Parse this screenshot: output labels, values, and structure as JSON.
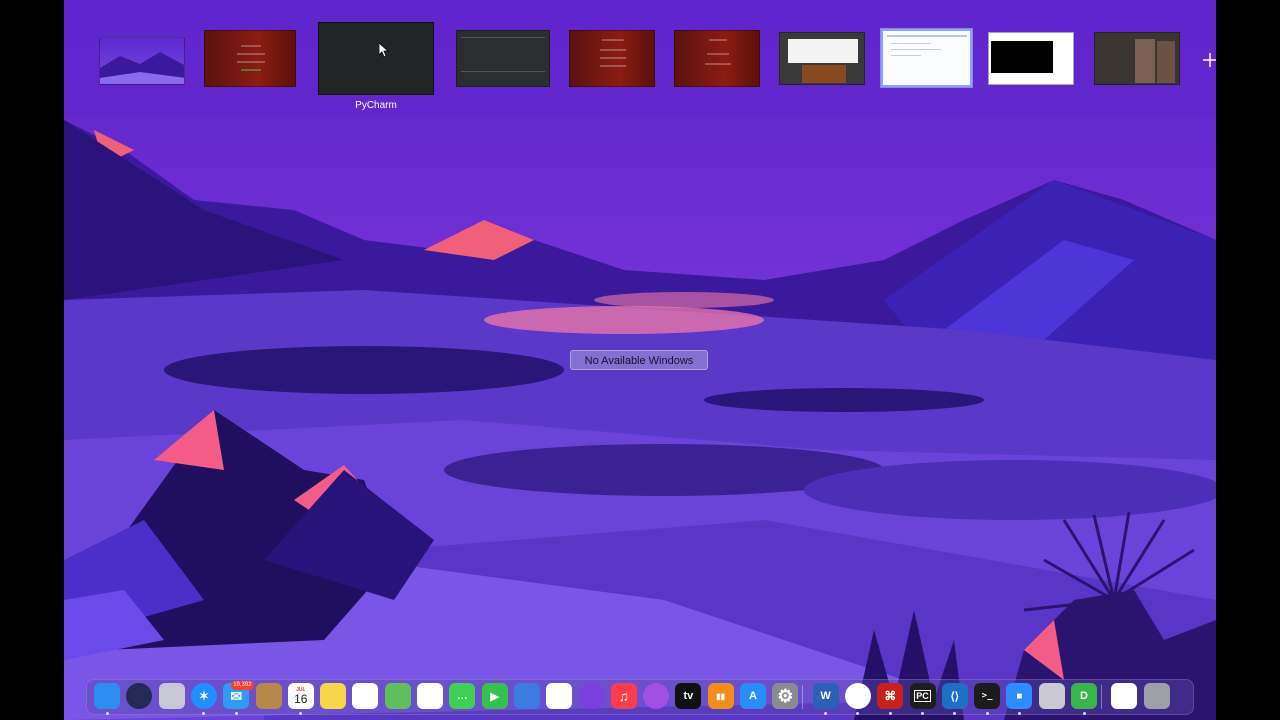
{
  "colors": {
    "wallpaper_sky": "#6d2fd6",
    "spaces_bar": "#6226cd",
    "selected_border": "#7fa9ff"
  },
  "spaces": {
    "items": [
      {
        "name": "wallpaper-desktop",
        "label": ""
      },
      {
        "name": "red-login-window",
        "label": ""
      },
      {
        "name": "pycharm-window",
        "label": "PyCharm"
      },
      {
        "name": "dark-editor-window",
        "label": ""
      },
      {
        "name": "red-form-window",
        "label": ""
      },
      {
        "name": "red-welcome-window",
        "label": ""
      },
      {
        "name": "browser-window",
        "label": ""
      },
      {
        "name": "selected-document-window",
        "label": ""
      },
      {
        "name": "video-window",
        "label": ""
      },
      {
        "name": "media-window",
        "label": ""
      }
    ],
    "add_icon": "plus-icon",
    "cursor_icon": "pointer-cursor-icon"
  },
  "desktop": {
    "no_windows_label": "No Available Windows"
  },
  "dock": {
    "apps": [
      {
        "name": "finder",
        "icon": "finder-icon",
        "color": "#2d8cf0",
        "running": true
      },
      {
        "name": "siri",
        "icon": "siri-icon",
        "color": "#232a55",
        "running": false
      },
      {
        "name": "launchpad",
        "icon": "launchpad-icon",
        "color": "#c7c7d6",
        "running": false
      },
      {
        "name": "safari",
        "icon": "safari-icon",
        "color": "#1e90ff",
        "running": true
      },
      {
        "name": "mail",
        "icon": "mail-icon",
        "color": "#2f9bf3",
        "running": true,
        "badge": "19,392"
      },
      {
        "name": "contacts",
        "icon": "contacts-icon",
        "color": "#b8884a",
        "running": false
      },
      {
        "name": "calendar",
        "icon": "calendar-icon",
        "color": "#ffffff",
        "running": true,
        "month": "JUL",
        "day": "16"
      },
      {
        "name": "notes",
        "icon": "notes-icon",
        "color": "#f7d64a",
        "running": false
      },
      {
        "name": "reminders",
        "icon": "reminders-icon",
        "color": "#ffffff",
        "running": false
      },
      {
        "name": "maps",
        "icon": "maps-icon",
        "color": "#5fbf5f",
        "running": false
      },
      {
        "name": "photos",
        "icon": "photos-icon",
        "color": "#ffffff",
        "running": false
      },
      {
        "name": "messages",
        "icon": "messages-icon",
        "color": "#3fcf55",
        "running": false
      },
      {
        "name": "facetime",
        "icon": "facetime-icon",
        "color": "#35c24c",
        "running": false
      },
      {
        "name": "keynote",
        "icon": "keynote-icon",
        "color": "#3e7be0",
        "running": false
      },
      {
        "name": "news",
        "icon": "news-icon",
        "color": "#ffffff",
        "running": false
      },
      {
        "name": "podcasts-radio",
        "icon": "radio-icon",
        "color": "#7b3fe0",
        "running": false
      },
      {
        "name": "music",
        "icon": "music-icon",
        "color": "#fa3c4c",
        "running": false
      },
      {
        "name": "podcasts",
        "icon": "podcasts-icon",
        "color": "#a050e0",
        "running": false
      },
      {
        "name": "apple-tv",
        "icon": "tv-icon",
        "color": "#111111",
        "label": "tv",
        "running": false
      },
      {
        "name": "books",
        "icon": "books-icon",
        "color": "#f28c1a",
        "running": false
      },
      {
        "name": "app-store",
        "icon": "app-store-icon",
        "color": "#2a8cf5",
        "running": false
      },
      {
        "name": "system-preferences",
        "icon": "gear-icon",
        "color": "#8a8a92",
        "running": false
      },
      {
        "name": "word",
        "icon": "word-icon",
        "color": "#2b5fb8",
        "label": "W",
        "running": true
      },
      {
        "name": "chrome",
        "icon": "chrome-icon",
        "color": "#ffffff",
        "running": true
      },
      {
        "name": "acrobat",
        "icon": "acrobat-icon",
        "color": "#c8201b",
        "running": true
      },
      {
        "name": "pycharm",
        "icon": "pycharm-icon",
        "color": "#1e1e1e",
        "label": "PC",
        "running": true
      },
      {
        "name": "vscode",
        "icon": "vscode-icon",
        "color": "#1f6fc5",
        "running": true
      },
      {
        "name": "terminal",
        "icon": "terminal-icon",
        "color": "#1c1c1c",
        "label": ">_",
        "running": true
      },
      {
        "name": "zoom",
        "icon": "zoom-icon",
        "color": "#2d8cff",
        "running": true
      },
      {
        "name": "archive",
        "icon": "archive-icon",
        "color": "#c9c9cf",
        "running": false
      },
      {
        "name": "dash",
        "icon": "dash-icon",
        "color": "#3ab54a",
        "label": "D",
        "running": true
      },
      {
        "name": "downloads-stack",
        "icon": "document-stack-icon",
        "color": "#ffffff",
        "running": false
      },
      {
        "name": "trash",
        "icon": "trash-icon",
        "color": "#9ea0a8",
        "running": false
      }
    ]
  }
}
